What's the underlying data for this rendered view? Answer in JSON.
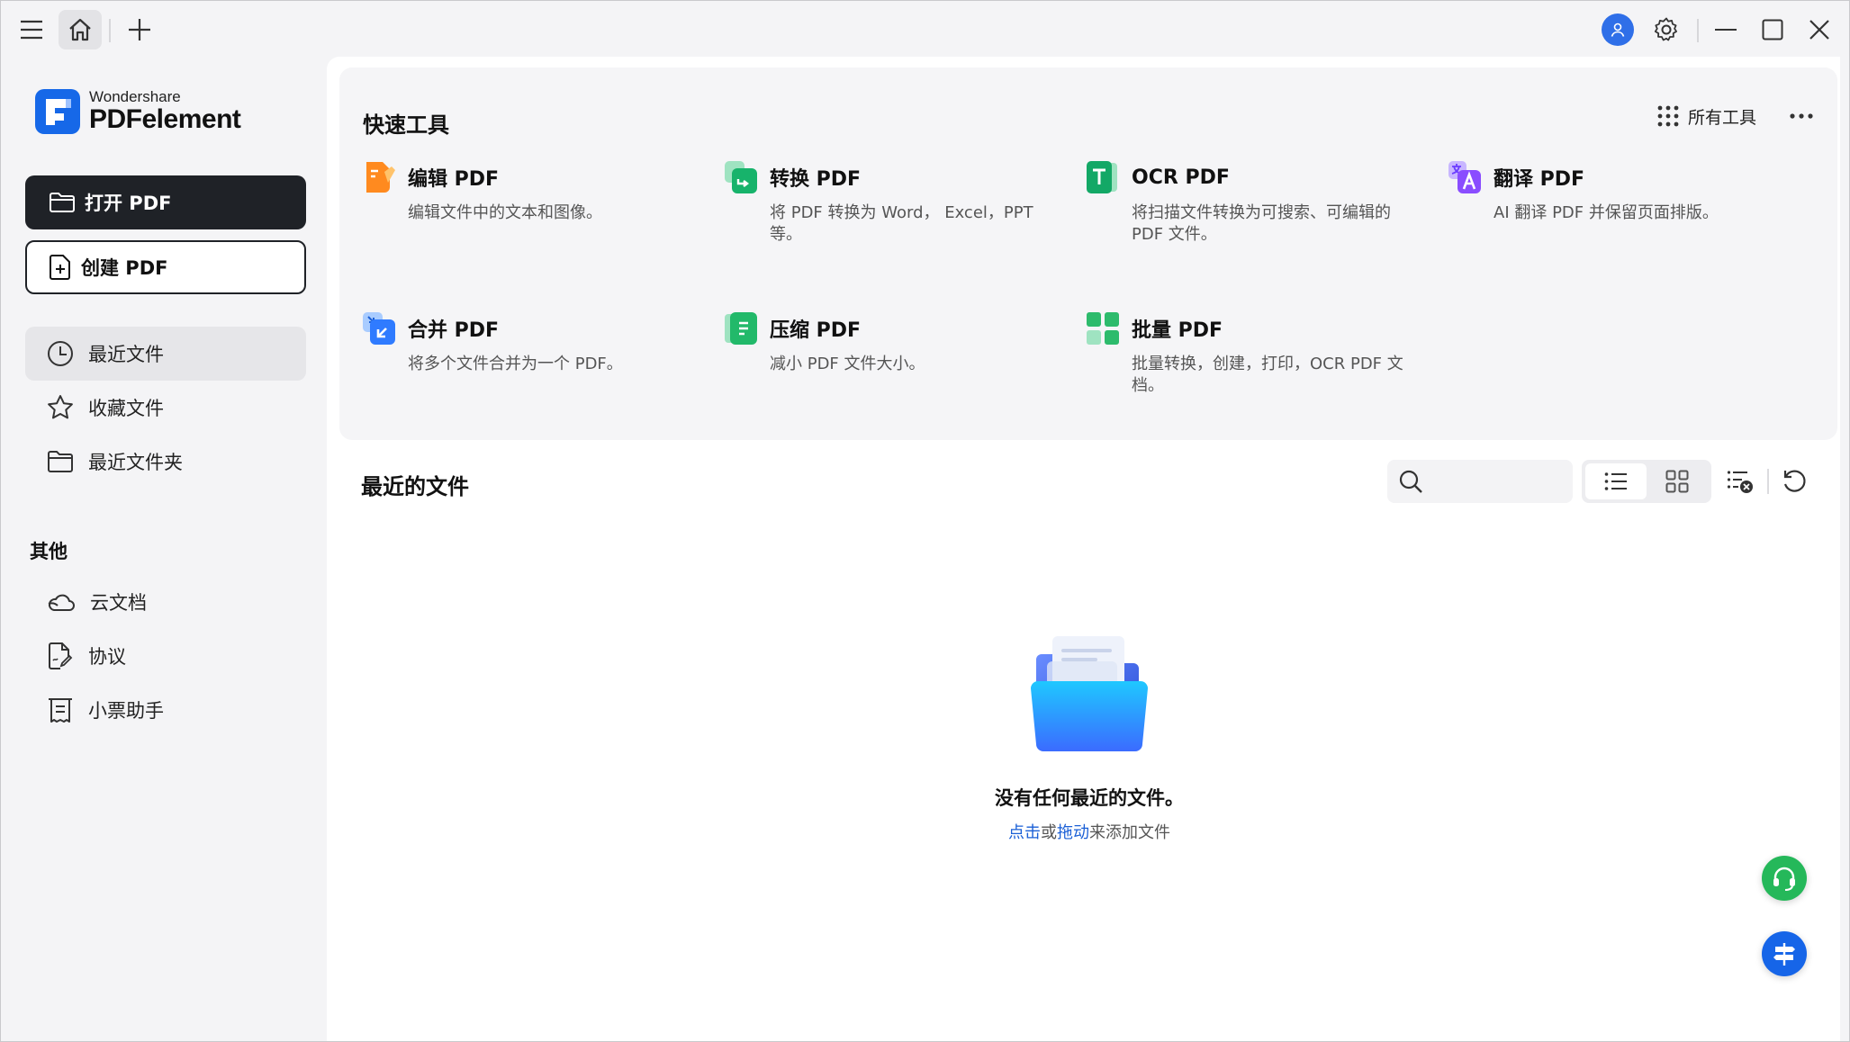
{
  "app": {
    "brand_small": "Wondershare",
    "brand_big": "PDFelement",
    "accent": "#1668e8"
  },
  "titlebar": {
    "icons": [
      "menu-icon",
      "home-icon",
      "plus-icon",
      "avatar-icon",
      "gear-icon",
      "minimize-icon",
      "maximize-icon",
      "close-icon"
    ]
  },
  "sidebar": {
    "open_label": "打开 PDF",
    "create_label": "创建 PDF",
    "nav": [
      {
        "label": "最近文件",
        "icon": "clock-icon",
        "active": true
      },
      {
        "label": "收藏文件",
        "icon": "star-icon",
        "active": false
      },
      {
        "label": "最近文件夹",
        "icon": "folder-icon",
        "active": false
      }
    ],
    "other_title": "其他",
    "other": [
      {
        "label": "云文档",
        "icon": "cloud-icon"
      },
      {
        "label": "协议",
        "icon": "agreement-icon"
      },
      {
        "label": "小票助手",
        "icon": "receipt-icon"
      }
    ]
  },
  "quick_tools": {
    "title": "快速工具",
    "all_tools_label": "所有工具",
    "tools": [
      {
        "name": "编辑 PDF",
        "desc": "编辑文件中的文本和图像。",
        "icon": "edit-pdf-icon"
      },
      {
        "name": "转换 PDF",
        "desc": "将 PDF 转换为 Word， Excel，PPT 等。",
        "icon": "convert-pdf-icon"
      },
      {
        "name": "OCR PDF",
        "desc": "将扫描文件转换为可搜索、可编辑的 PDF 文件。",
        "icon": "ocr-pdf-icon"
      },
      {
        "name": "翻译 PDF",
        "desc": "AI 翻译 PDF 并保留页面排版。",
        "icon": "translate-pdf-icon"
      },
      {
        "name": "合并 PDF",
        "desc": "将多个文件合并为一个 PDF。",
        "icon": "merge-pdf-icon"
      },
      {
        "name": "压缩 PDF",
        "desc": "减小 PDF 文件大小。",
        "icon": "compress-pdf-icon"
      },
      {
        "name": "批量 PDF",
        "desc": "批量转换，创建，打印，OCR PDF 文档。",
        "icon": "batch-pdf-icon"
      }
    ]
  },
  "recent": {
    "title": "最近的文件",
    "search_placeholder": "",
    "view_mode": "list",
    "empty_title": "没有任何最近的文件。",
    "hint_click": "点击",
    "hint_or": "或",
    "hint_drag": "拖动",
    "hint_rest": "来添加文件"
  }
}
